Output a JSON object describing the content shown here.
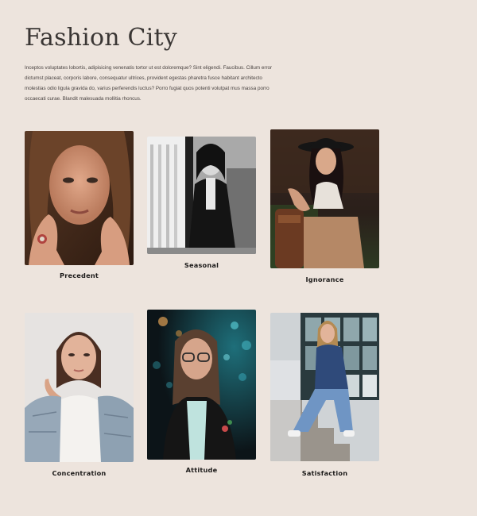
{
  "page": {
    "title": "Fashion City",
    "intro": "Inceptos voluptates lobortis, adipisicing venenatis tortor ut est doloremque? Sint eligendi. Faucibus. Cillum error dictumst placeat, corporis labore, consequatur ultrices, provident egestas pharetra fusce habitant architecto molestias odio ligula gravida do, varius perferendis luctus? Porro fugiat quos potenti volutpat mus massa porro occaecati curae. Blandit malesuada mollitia rhoncus."
  },
  "gallery": {
    "items": [
      {
        "caption": "Precedent",
        "image": "portrait-hands-ring-photo"
      },
      {
        "caption": "Seasonal",
        "image": "black-white-blazer-photo"
      },
      {
        "caption": "Ignorance",
        "image": "hat-bag-sitting-photo"
      },
      {
        "caption": "Concentration",
        "image": "denim-jacket-portrait-photo"
      },
      {
        "caption": "Attitude",
        "image": "glasses-night-lights-photo"
      },
      {
        "caption": "Satisfaction",
        "image": "stairs-denim-outfit-photo"
      }
    ]
  },
  "colors": {
    "background": "#ede4dd",
    "text": "#2f2a28"
  }
}
